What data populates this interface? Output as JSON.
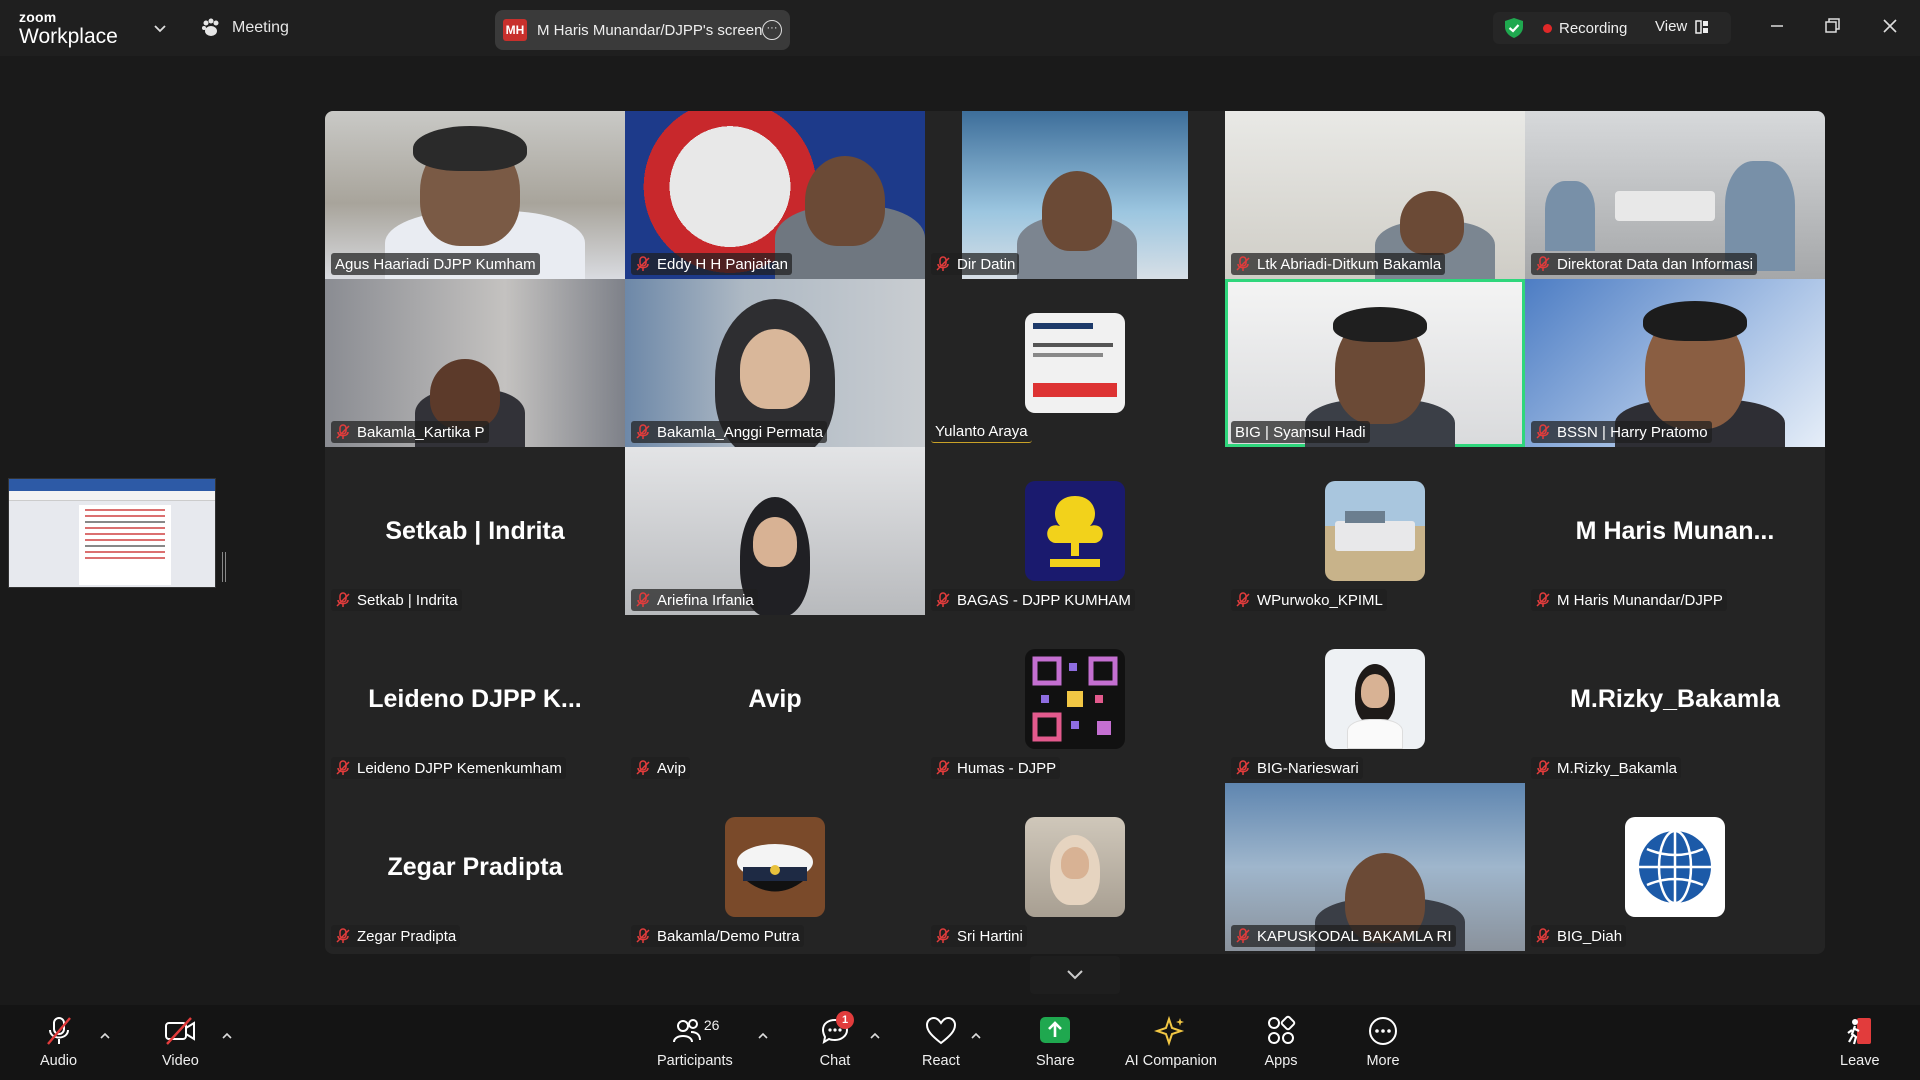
{
  "app": {
    "logo_small": "zoom",
    "logo_big": "Workplace"
  },
  "topbar": {
    "meeting_label": "Meeting",
    "share_badge": "MH",
    "share_label": "M Haris Munandar/DJPP's screen",
    "share_more": "···",
    "recording_label": "Recording",
    "view_label": "View"
  },
  "gallery": {
    "tiles": [
      {
        "label": "Agus Haariadi DJPP Kumham",
        "muted": false,
        "kind": "video"
      },
      {
        "label": "Eddy H H Panjaitan",
        "muted": true,
        "kind": "video"
      },
      {
        "label": "Dir Datin",
        "muted": true,
        "kind": "video"
      },
      {
        "label": "Ltk Abriadi-Ditkum Bakamla",
        "muted": true,
        "kind": "video"
      },
      {
        "label": "Direktorat Data dan Informasi",
        "muted": true,
        "kind": "video"
      },
      {
        "label": "Bakamla_Kartika P",
        "muted": true,
        "kind": "video"
      },
      {
        "label": "Bakamla_Anggi Permata",
        "muted": true,
        "kind": "video"
      },
      {
        "label": "Yulanto Araya",
        "muted": false,
        "kind": "avatar"
      },
      {
        "label": "BIG | Syamsul Hadi",
        "muted": false,
        "kind": "video",
        "speaking": true
      },
      {
        "label": "BSSN | Harry Pratomo",
        "muted": true,
        "kind": "video"
      },
      {
        "label": "Setkab | Indrita",
        "muted": true,
        "kind": "name",
        "big_name": "Setkab | Indrita"
      },
      {
        "label": "Ariefina Irfania",
        "muted": true,
        "kind": "video"
      },
      {
        "label": "BAGAS - DJPP KUMHAM",
        "muted": true,
        "kind": "avatar"
      },
      {
        "label": "WPurwoko_KPIML",
        "muted": true,
        "kind": "avatar"
      },
      {
        "label": "M Haris Munandar/DJPP",
        "muted": true,
        "kind": "name",
        "big_name": "M Haris Munan..."
      },
      {
        "label": "Leideno DJPP Kemenkumham",
        "muted": true,
        "kind": "name",
        "big_name": "Leideno DJPP K..."
      },
      {
        "label": "Avip",
        "muted": true,
        "kind": "name",
        "big_name": "Avip"
      },
      {
        "label": "Humas - DJPP",
        "muted": true,
        "kind": "avatar"
      },
      {
        "label": "BIG-Narieswari",
        "muted": true,
        "kind": "avatar"
      },
      {
        "label": "M.Rizky_Bakamla",
        "muted": true,
        "kind": "name",
        "big_name": "M.Rizky_Bakamla"
      },
      {
        "label": "Zegar Pradipta",
        "muted": true,
        "kind": "name",
        "big_name": "Zegar Pradipta"
      },
      {
        "label": "Bakamla/Demo Putra",
        "muted": true,
        "kind": "avatar"
      },
      {
        "label": "Sri Hartini",
        "muted": true,
        "kind": "avatar"
      },
      {
        "label": "KAPUSKODAL BAKAMLA RI",
        "muted": true,
        "kind": "video"
      },
      {
        "label": "BIG_Diah",
        "muted": true,
        "kind": "avatar"
      }
    ]
  },
  "toolbar": {
    "audio": "Audio",
    "video": "Video",
    "participants": "Participants",
    "participants_count": "26",
    "chat": "Chat",
    "chat_badge": "1",
    "react": "React",
    "share": "Share",
    "ai_companion": "AI Companion",
    "apps": "Apps",
    "more": "More",
    "leave": "Leave"
  },
  "colors": {
    "accent_green": "#2fd67c",
    "muted_red": "#e23c3c",
    "share_green": "#1fa84f",
    "ai_yellow": "#f2c744"
  }
}
